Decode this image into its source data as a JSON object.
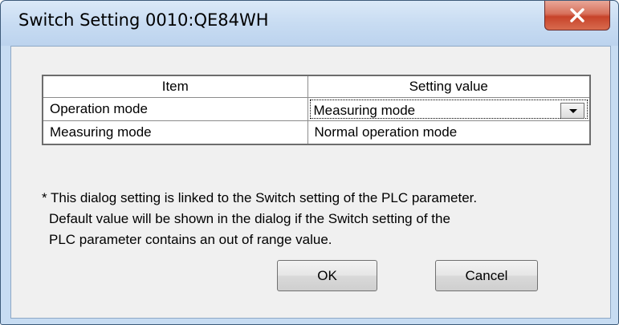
{
  "window": {
    "title": "Switch Setting 0010:QE84WH",
    "close_icon": "close-icon"
  },
  "grid": {
    "headers": [
      "Item",
      "Setting value"
    ],
    "rows": [
      {
        "item": "Operation mode",
        "value": "Measuring mode",
        "control": "dropdown"
      },
      {
        "item": "Measuring mode",
        "value": "Normal operation mode",
        "control": "text"
      }
    ]
  },
  "note": {
    "line1": "* This dialog setting is linked to the Switch setting of the PLC parameter.",
    "line2": "Default value will be shown in the dialog if the Switch setting of the",
    "line3": "PLC parameter contains an out of range value."
  },
  "buttons": {
    "ok_label": "OK",
    "cancel_label": "Cancel"
  },
  "colors": {
    "close_button": "#c7432a",
    "window_frame": "#c7dcf2",
    "client_bg": "#f0f0f0"
  }
}
